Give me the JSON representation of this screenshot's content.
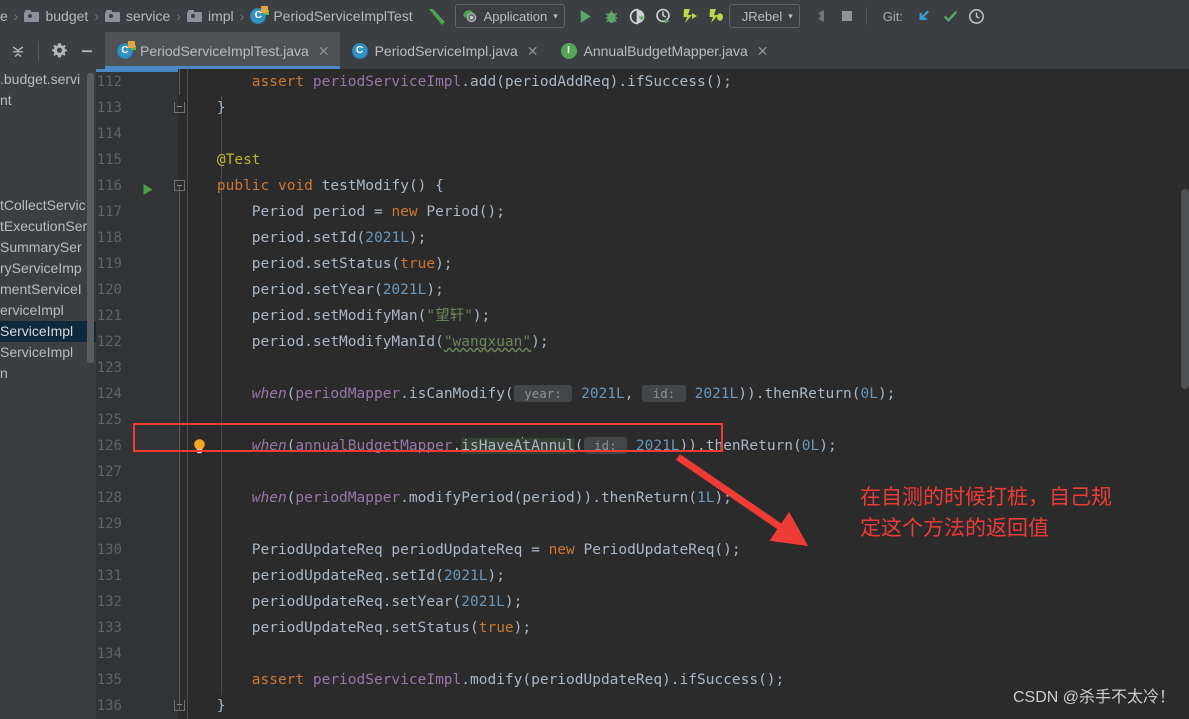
{
  "window": {
    "app": "IntelliJ IDEA",
    "watermark": "CSDN @杀手不太冷！"
  },
  "breadcrumb": {
    "items": [
      {
        "label": "e",
        "icon": "truncated-crumb",
        "type": "text"
      },
      {
        "label": "budget",
        "icon": "folder-icon",
        "type": "folder"
      },
      {
        "label": "service",
        "icon": "folder-icon",
        "type": "folder"
      },
      {
        "label": "impl",
        "icon": "folder-icon",
        "type": "folder"
      },
      {
        "label": "PeriodServiceImplTest",
        "icon": "java-test-class-icon",
        "type": "class"
      }
    ],
    "separator": "›"
  },
  "toolbar": {
    "make_project_icon": "hammer-icon",
    "run_config": {
      "label": "Application",
      "icon": "run-configuration-icon",
      "chevron": "▾"
    },
    "buttons": [
      {
        "name": "run-button",
        "icon": "play-icon",
        "color": "#59a869"
      },
      {
        "name": "debug-button",
        "icon": "bug-icon",
        "color": "#59a869"
      },
      {
        "name": "run-with-coverage-button",
        "icon": "coverage-icon",
        "color": "#cfd2d4"
      },
      {
        "name": "profile-button",
        "icon": "profiler-icon",
        "color": "#cfd2d4"
      },
      {
        "name": "jrebel-run-button",
        "icon": "jrebel-play-icon",
        "color": "#b8d94a"
      },
      {
        "name": "jrebel-debug-button",
        "icon": "jrebel-bug-icon",
        "color": "#b8d94a"
      }
    ],
    "jrebel": {
      "label": "JRebel",
      "chevron": "▾"
    },
    "attach_icon": "attach-profiler-icon",
    "stop_icon": "stop-icon",
    "git": {
      "label": "Git:",
      "update_icon": "update-project-icon",
      "commit_icon": "commit-checkmark-icon",
      "history_icon": "rollback-icon"
    }
  },
  "editor_controls": {
    "collapse_icon": "expand-collapse-icon",
    "settings_icon": "gear-icon",
    "hide_icon": "minimize-icon"
  },
  "tabs": [
    {
      "label": "PeriodServiceImplTest.java",
      "icon": "java-test-class-icon",
      "active": true,
      "close": "✕"
    },
    {
      "label": "PeriodServiceImpl.java",
      "icon": "java-class-icon",
      "active": false,
      "close": "✕"
    },
    {
      "label": "AnnualBudgetMapper.java",
      "icon": "java-interface-icon",
      "active": false,
      "close": "✕"
    }
  ],
  "project_panel": {
    "items": [
      {
        "label": ".budget.servi",
        "selected": false
      },
      {
        "label": "nt",
        "selected": false
      },
      {
        "label": "",
        "selected": false
      },
      {
        "label": "",
        "selected": false
      },
      {
        "label": "",
        "selected": false
      },
      {
        "label": "",
        "selected": false
      },
      {
        "label": "tCollectServic",
        "selected": false
      },
      {
        "label": "tExecutionSer",
        "selected": false
      },
      {
        "label": "SummarySer",
        "selected": false
      },
      {
        "label": "ryServiceImp",
        "selected": false
      },
      {
        "label": "mentServiceI",
        "selected": false
      },
      {
        "label": "erviceImpl",
        "selected": false
      },
      {
        "label": "ServiceImpl",
        "selected": true
      },
      {
        "label": "ServiceImpl",
        "selected": false
      },
      {
        "label": "n",
        "selected": false
      }
    ]
  },
  "code": {
    "first_line": 112,
    "lines": [
      {
        "n": 112,
        "indent": 8,
        "tokens": [
          {
            "t": "assert ",
            "c": "kw"
          },
          {
            "t": "periodServiceImpl",
            "c": "field"
          },
          {
            "t": ".add(periodAddReq).ifSuccess();",
            "c": "plain"
          }
        ]
      },
      {
        "n": 113,
        "indent": 4,
        "fold": "end",
        "tokens": [
          {
            "t": "}",
            "c": "plain"
          }
        ]
      },
      {
        "n": 114,
        "indent": 0,
        "tokens": []
      },
      {
        "n": 115,
        "indent": 4,
        "tokens": [
          {
            "t": "@Test",
            "c": "anno"
          }
        ]
      },
      {
        "n": 116,
        "indent": 4,
        "run": true,
        "fold": "start",
        "tokens": [
          {
            "t": "public ",
            "c": "kw"
          },
          {
            "t": "void ",
            "c": "kw"
          },
          {
            "t": "testModify",
            "c": "meth"
          },
          {
            "t": "() {",
            "c": "plain"
          }
        ]
      },
      {
        "n": 117,
        "indent": 8,
        "tokens": [
          {
            "t": "Period period = ",
            "c": "plain"
          },
          {
            "t": "new ",
            "c": "kw"
          },
          {
            "t": "Period();",
            "c": "plain"
          }
        ]
      },
      {
        "n": 118,
        "indent": 8,
        "tokens": [
          {
            "t": "period.setId(",
            "c": "plain"
          },
          {
            "t": "2021L",
            "c": "num"
          },
          {
            "t": ");",
            "c": "plain"
          }
        ]
      },
      {
        "n": 119,
        "indent": 8,
        "tokens": [
          {
            "t": "period.setStatus(",
            "c": "plain"
          },
          {
            "t": "true",
            "c": "kw"
          },
          {
            "t": ");",
            "c": "plain"
          }
        ]
      },
      {
        "n": 120,
        "indent": 8,
        "tokens": [
          {
            "t": "period.setYear(",
            "c": "plain"
          },
          {
            "t": "2021L",
            "c": "num"
          },
          {
            "t": ");",
            "c": "plain"
          }
        ]
      },
      {
        "n": 121,
        "indent": 8,
        "tokens": [
          {
            "t": "period.setModifyMan(",
            "c": "plain"
          },
          {
            "t": "\"望轩\"",
            "c": "str"
          },
          {
            "t": ");",
            "c": "plain"
          }
        ]
      },
      {
        "n": 122,
        "indent": 8,
        "tokens": [
          {
            "t": "period.setModifyManId(",
            "c": "plain"
          },
          {
            "t": "\"wangxuan\"",
            "c": "str squig"
          },
          {
            "t": ");",
            "c": "plain"
          }
        ]
      },
      {
        "n": 123,
        "indent": 0,
        "tokens": []
      },
      {
        "n": 124,
        "indent": 8,
        "tokens": [
          {
            "t": "when",
            "c": "stat"
          },
          {
            "t": "(",
            "c": "plain"
          },
          {
            "t": "periodMapper",
            "c": "field"
          },
          {
            "t": ".isCanModify(",
            "c": "plain"
          },
          {
            "t": " year: ",
            "c": "hint"
          },
          {
            "t": " ",
            "c": "plain"
          },
          {
            "t": "2021L",
            "c": "num"
          },
          {
            "t": ", ",
            "c": "plain"
          },
          {
            "t": " id: ",
            "c": "hint"
          },
          {
            "t": " ",
            "c": "plain"
          },
          {
            "t": "2021L",
            "c": "num"
          },
          {
            "t": ")).thenReturn(",
            "c": "plain"
          },
          {
            "t": "0L",
            "c": "num"
          },
          {
            "t": ");",
            "c": "plain"
          }
        ]
      },
      {
        "n": 125,
        "indent": 0,
        "tokens": []
      },
      {
        "n": 126,
        "indent": 8,
        "bulb": true,
        "highlight": true,
        "tokens": [
          {
            "t": "when",
            "c": "stat"
          },
          {
            "t": "(",
            "c": "plain"
          },
          {
            "t": "annualBudgetMapper",
            "c": "field"
          },
          {
            "t": ".",
            "c": "plain"
          },
          {
            "t": "isHaveA",
            "c": "plain selhl"
          },
          {
            "t": "CARET",
            "c": "caret"
          },
          {
            "t": "tAnnul",
            "c": "plain selhl"
          },
          {
            "t": "(",
            "c": "plain"
          },
          {
            "t": " id: ",
            "c": "hint"
          },
          {
            "t": " ",
            "c": "plain"
          },
          {
            "t": "2021L",
            "c": "num"
          },
          {
            "t": ")).thenReturn(",
            "c": "plain"
          },
          {
            "t": "0L",
            "c": "num"
          },
          {
            "t": ");",
            "c": "plain"
          }
        ]
      },
      {
        "n": 127,
        "indent": 0,
        "tokens": []
      },
      {
        "n": 128,
        "indent": 8,
        "tokens": [
          {
            "t": "when",
            "c": "stat"
          },
          {
            "t": "(",
            "c": "plain"
          },
          {
            "t": "periodMapper",
            "c": "field"
          },
          {
            "t": ".modifyPeriod(period)).thenReturn(",
            "c": "plain"
          },
          {
            "t": "1L",
            "c": "num"
          },
          {
            "t": ");",
            "c": "plain"
          }
        ]
      },
      {
        "n": 129,
        "indent": 0,
        "tokens": []
      },
      {
        "n": 130,
        "indent": 8,
        "tokens": [
          {
            "t": "PeriodUpdateReq periodUpdateReq = ",
            "c": "plain"
          },
          {
            "t": "new ",
            "c": "kw"
          },
          {
            "t": "PeriodUpdateReq();",
            "c": "plain"
          }
        ]
      },
      {
        "n": 131,
        "indent": 8,
        "tokens": [
          {
            "t": "periodUpdateReq.setId(",
            "c": "plain"
          },
          {
            "t": "2021L",
            "c": "num"
          },
          {
            "t": ");",
            "c": "plain"
          }
        ]
      },
      {
        "n": 132,
        "indent": 8,
        "tokens": [
          {
            "t": "periodUpdateReq.setYear(",
            "c": "plain"
          },
          {
            "t": "2021L",
            "c": "num"
          },
          {
            "t": ");",
            "c": "plain"
          }
        ]
      },
      {
        "n": 133,
        "indent": 8,
        "tokens": [
          {
            "t": "periodUpdateReq.setStatus(",
            "c": "plain"
          },
          {
            "t": "true",
            "c": "kw"
          },
          {
            "t": ");",
            "c": "plain"
          }
        ]
      },
      {
        "n": 134,
        "indent": 0,
        "tokens": []
      },
      {
        "n": 135,
        "indent": 8,
        "tokens": [
          {
            "t": "assert ",
            "c": "kw"
          },
          {
            "t": "periodServiceImpl",
            "c": "field"
          },
          {
            "t": ".modify(periodUpdateReq).ifSuccess();",
            "c": "plain"
          }
        ]
      },
      {
        "n": 136,
        "indent": 4,
        "fold": "end",
        "tokens": [
          {
            "t": "}",
            "c": "plain"
          }
        ]
      }
    ]
  },
  "annotation": {
    "color": "#ef3b36",
    "line1": "在自测的时候打桩，自己规",
    "line2": "定这个方法的返回值",
    "box_label": "highlight-box-around-line-126",
    "arrow_label": "red-pointer-arrow"
  }
}
